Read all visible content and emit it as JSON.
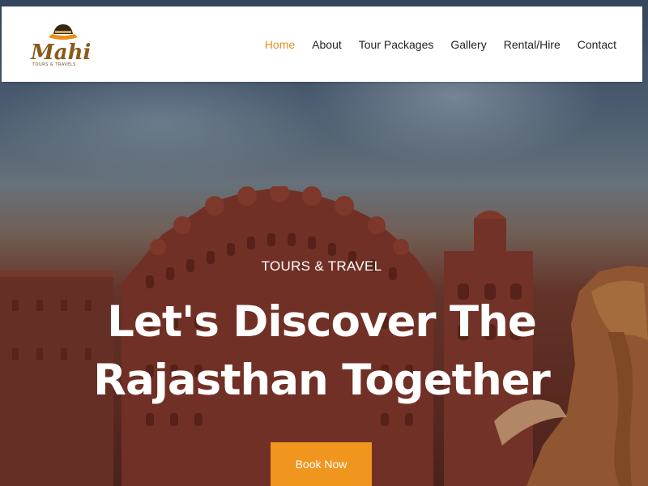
{
  "header": {
    "logo": {
      "word": "Mahi",
      "tagline": "TOURS & TRAVELS"
    },
    "nav": [
      {
        "label": "Home",
        "active": true
      },
      {
        "label": "About",
        "active": false
      },
      {
        "label": "Tour Packages",
        "active": false
      },
      {
        "label": "Gallery",
        "active": false
      },
      {
        "label": "Rental/Hire",
        "active": false
      },
      {
        "label": "Contact",
        "active": false
      }
    ]
  },
  "hero": {
    "eyebrow": "TOURS & TRAVEL",
    "headline_line1": "Let's Discover The",
    "headline_line2": "Rajasthan Together",
    "cta_label": "Book Now"
  },
  "colors": {
    "accent": "#f0951d",
    "nav_active": "#e89019",
    "logo_brown": "#8a5a1a"
  }
}
